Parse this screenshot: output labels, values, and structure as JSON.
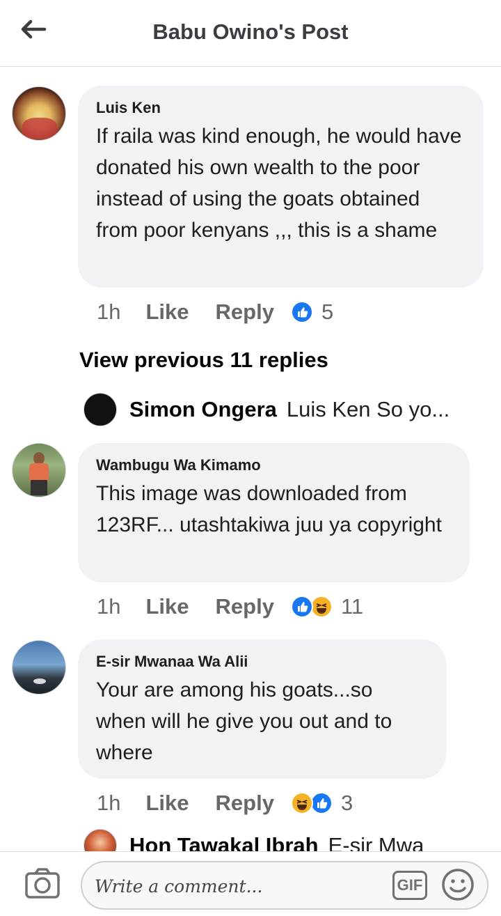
{
  "header": {
    "title": "Babu Owino's Post"
  },
  "comments": [
    {
      "author": "Luis Ken",
      "text": "If raila was kind enough, he would have donated his own wealth to the poor instead of using the goats obtained from poor kenyans ,,, this is a shame",
      "time": "1h",
      "like_label": "Like",
      "reply_label": "Reply",
      "reactions": [
        "like"
      ],
      "reaction_count": "5"
    },
    {
      "author": "Wambugu Wa Kimamo",
      "text": "This image was downloaded from 123RF... utashtakiwa juu ya copyright",
      "time": "1h",
      "like_label": "Like",
      "reply_label": "Reply",
      "reactions": [
        "like",
        "haha"
      ],
      "reaction_count": "11"
    },
    {
      "author": "E-sir Mwanaa Wa Alii",
      "text": "Your are among his goats...so when will he give you out and to where",
      "time": "1h",
      "like_label": "Like",
      "reply_label": "Reply",
      "reactions": [
        "haha",
        "like"
      ],
      "reaction_count": "3"
    }
  ],
  "view_previous": "View previous 11 replies",
  "reply_preview": {
    "author": "Simon Ongera",
    "text": "Luis Ken So yo..."
  },
  "partial_reply": {
    "author": "Hon Tawakal Ibrah",
    "text": "E-sir Mwa"
  },
  "composer": {
    "placeholder": "Write a comment...",
    "gif_label": "GIF"
  },
  "colors": {
    "like_blue": "#1877f2",
    "haha_yellow": "#f7b125",
    "bubble": "#f0f2f5",
    "meta_gray": "#65676b"
  },
  "icons": [
    "back-arrow-icon",
    "like-reaction-icon",
    "haha-reaction-icon",
    "camera-icon",
    "gif-icon",
    "emoji-icon"
  ]
}
